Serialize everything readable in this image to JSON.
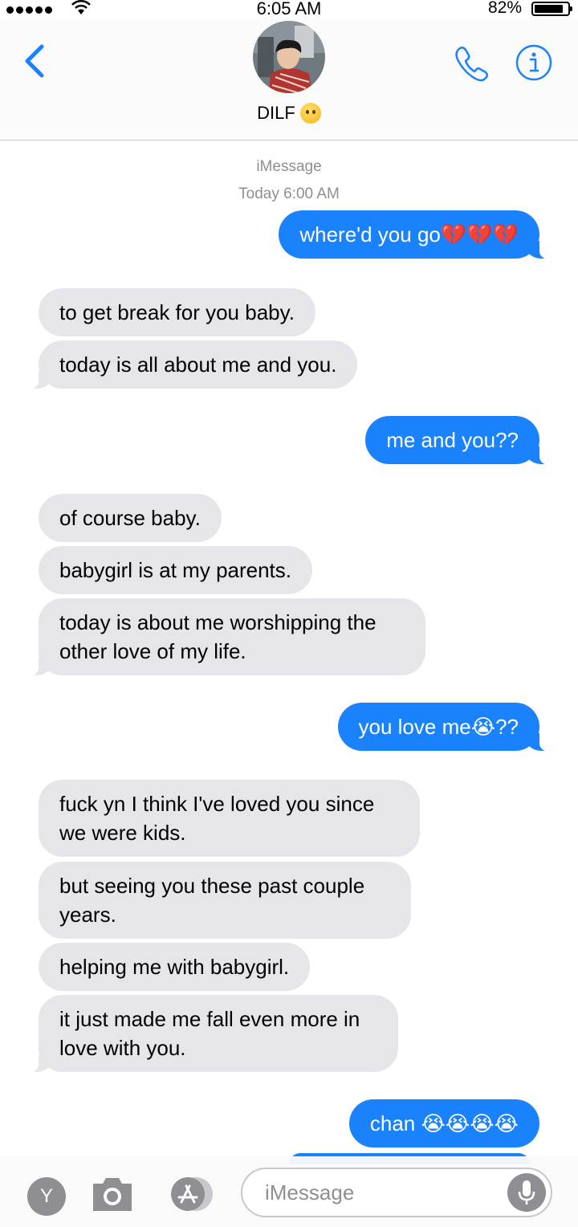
{
  "status": {
    "time": "6:05 AM",
    "battery_pct": "82%"
  },
  "header": {
    "contact_name": "DILF",
    "name_emoji": "shushing-face-emoji"
  },
  "thread": {
    "service": "iMessage",
    "timestamp": "Today 6:00 AM",
    "messages": [
      {
        "from": "me",
        "text": "where'd you go💔💔💔"
      },
      {
        "from": "them",
        "text": "to get break for you baby."
      },
      {
        "from": "them",
        "text": "today is all about me and you."
      },
      {
        "from": "me",
        "text": "me and you??"
      },
      {
        "from": "them",
        "text": "of course baby."
      },
      {
        "from": "them",
        "text": "babygirl is at my parents."
      },
      {
        "from": "them",
        "text": "today is about me worshipping the other love of my life."
      },
      {
        "from": "me",
        "text": "you love me😭??"
      },
      {
        "from": "them",
        "text": "fuck yn I think I've loved you since we were kids."
      },
      {
        "from": "them",
        "text": "but seeing you these past couple years."
      },
      {
        "from": "them",
        "text": "helping me with babygirl."
      },
      {
        "from": "them",
        "text": "it just made me fall even more in love with you."
      },
      {
        "from": "me",
        "text": "chan 😭😭😭😭"
      }
    ]
  },
  "composer": {
    "avatar_letter": "Y",
    "placeholder": "iMessage"
  },
  "colors": {
    "accent": "#1982fc",
    "incoming": "#e5e5ea",
    "meta": "#8e8e93"
  }
}
